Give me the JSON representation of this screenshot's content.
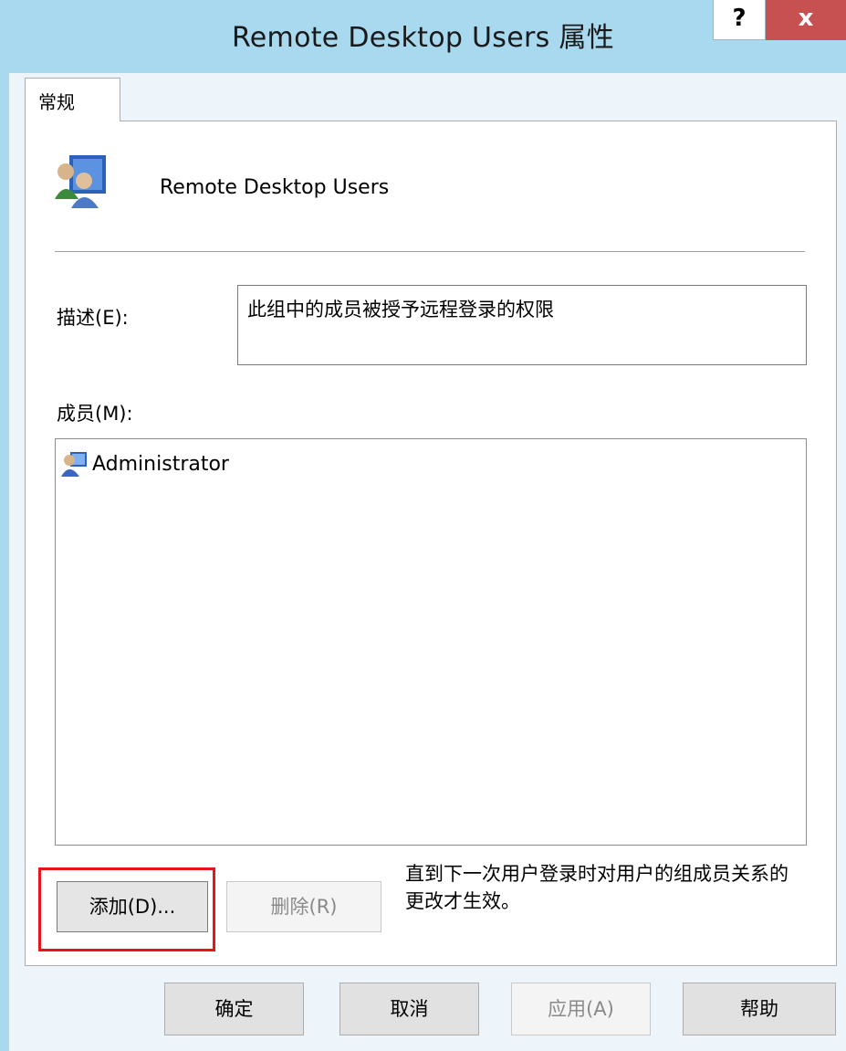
{
  "window": {
    "title": "Remote Desktop Users 属性",
    "help_glyph": "?",
    "close_glyph": "x"
  },
  "tabs": [
    {
      "label": "常规",
      "selected": true
    }
  ],
  "general": {
    "group_name": "Remote Desktop Users",
    "description_label": "描述(E):",
    "description_value": "此组中的成员被授予远程登录的权限",
    "members_label": "成员(M):",
    "members": [
      {
        "name": "Administrator",
        "icon": "user-icon"
      }
    ],
    "note": "直到下一次用户登录时对用户的组成员关系的更改才生效。"
  },
  "buttons": {
    "add": "添加(D)...",
    "remove": "删除(R)",
    "ok": "确定",
    "cancel": "取消",
    "apply": "应用(A)",
    "help": "帮助"
  },
  "colors": {
    "titlebar": "#a9d9ef",
    "close": "#c75050",
    "highlight": "#e8141a"
  }
}
